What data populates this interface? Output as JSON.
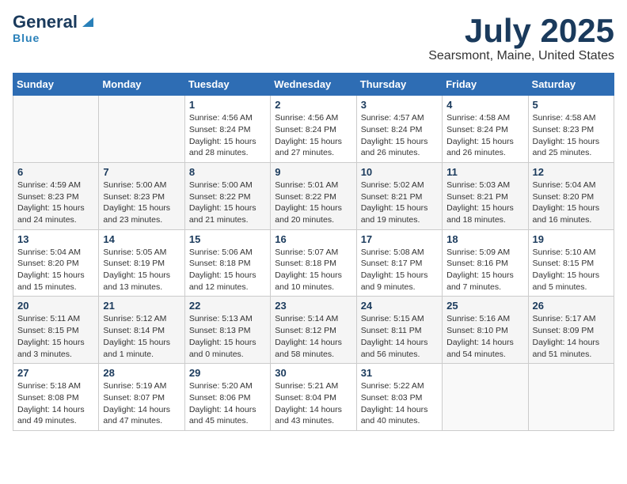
{
  "header": {
    "logo_general": "General",
    "logo_blue": "Blue",
    "title": "July 2025",
    "subtitle": "Searsmont, Maine, United States"
  },
  "calendar": {
    "weekdays": [
      "Sunday",
      "Monday",
      "Tuesday",
      "Wednesday",
      "Thursday",
      "Friday",
      "Saturday"
    ],
    "weeks": [
      [
        {
          "day": "",
          "info": ""
        },
        {
          "day": "",
          "info": ""
        },
        {
          "day": "1",
          "info": "Sunrise: 4:56 AM\nSunset: 8:24 PM\nDaylight: 15 hours and 28 minutes."
        },
        {
          "day": "2",
          "info": "Sunrise: 4:56 AM\nSunset: 8:24 PM\nDaylight: 15 hours and 27 minutes."
        },
        {
          "day": "3",
          "info": "Sunrise: 4:57 AM\nSunset: 8:24 PM\nDaylight: 15 hours and 26 minutes."
        },
        {
          "day": "4",
          "info": "Sunrise: 4:58 AM\nSunset: 8:24 PM\nDaylight: 15 hours and 26 minutes."
        },
        {
          "day": "5",
          "info": "Sunrise: 4:58 AM\nSunset: 8:23 PM\nDaylight: 15 hours and 25 minutes."
        }
      ],
      [
        {
          "day": "6",
          "info": "Sunrise: 4:59 AM\nSunset: 8:23 PM\nDaylight: 15 hours and 24 minutes."
        },
        {
          "day": "7",
          "info": "Sunrise: 5:00 AM\nSunset: 8:23 PM\nDaylight: 15 hours and 23 minutes."
        },
        {
          "day": "8",
          "info": "Sunrise: 5:00 AM\nSunset: 8:22 PM\nDaylight: 15 hours and 21 minutes."
        },
        {
          "day": "9",
          "info": "Sunrise: 5:01 AM\nSunset: 8:22 PM\nDaylight: 15 hours and 20 minutes."
        },
        {
          "day": "10",
          "info": "Sunrise: 5:02 AM\nSunset: 8:21 PM\nDaylight: 15 hours and 19 minutes."
        },
        {
          "day": "11",
          "info": "Sunrise: 5:03 AM\nSunset: 8:21 PM\nDaylight: 15 hours and 18 minutes."
        },
        {
          "day": "12",
          "info": "Sunrise: 5:04 AM\nSunset: 8:20 PM\nDaylight: 15 hours and 16 minutes."
        }
      ],
      [
        {
          "day": "13",
          "info": "Sunrise: 5:04 AM\nSunset: 8:20 PM\nDaylight: 15 hours and 15 minutes."
        },
        {
          "day": "14",
          "info": "Sunrise: 5:05 AM\nSunset: 8:19 PM\nDaylight: 15 hours and 13 minutes."
        },
        {
          "day": "15",
          "info": "Sunrise: 5:06 AM\nSunset: 8:18 PM\nDaylight: 15 hours and 12 minutes."
        },
        {
          "day": "16",
          "info": "Sunrise: 5:07 AM\nSunset: 8:18 PM\nDaylight: 15 hours and 10 minutes."
        },
        {
          "day": "17",
          "info": "Sunrise: 5:08 AM\nSunset: 8:17 PM\nDaylight: 15 hours and 9 minutes."
        },
        {
          "day": "18",
          "info": "Sunrise: 5:09 AM\nSunset: 8:16 PM\nDaylight: 15 hours and 7 minutes."
        },
        {
          "day": "19",
          "info": "Sunrise: 5:10 AM\nSunset: 8:15 PM\nDaylight: 15 hours and 5 minutes."
        }
      ],
      [
        {
          "day": "20",
          "info": "Sunrise: 5:11 AM\nSunset: 8:15 PM\nDaylight: 15 hours and 3 minutes."
        },
        {
          "day": "21",
          "info": "Sunrise: 5:12 AM\nSunset: 8:14 PM\nDaylight: 15 hours and 1 minute."
        },
        {
          "day": "22",
          "info": "Sunrise: 5:13 AM\nSunset: 8:13 PM\nDaylight: 15 hours and 0 minutes."
        },
        {
          "day": "23",
          "info": "Sunrise: 5:14 AM\nSunset: 8:12 PM\nDaylight: 14 hours and 58 minutes."
        },
        {
          "day": "24",
          "info": "Sunrise: 5:15 AM\nSunset: 8:11 PM\nDaylight: 14 hours and 56 minutes."
        },
        {
          "day": "25",
          "info": "Sunrise: 5:16 AM\nSunset: 8:10 PM\nDaylight: 14 hours and 54 minutes."
        },
        {
          "day": "26",
          "info": "Sunrise: 5:17 AM\nSunset: 8:09 PM\nDaylight: 14 hours and 51 minutes."
        }
      ],
      [
        {
          "day": "27",
          "info": "Sunrise: 5:18 AM\nSunset: 8:08 PM\nDaylight: 14 hours and 49 minutes."
        },
        {
          "day": "28",
          "info": "Sunrise: 5:19 AM\nSunset: 8:07 PM\nDaylight: 14 hours and 47 minutes."
        },
        {
          "day": "29",
          "info": "Sunrise: 5:20 AM\nSunset: 8:06 PM\nDaylight: 14 hours and 45 minutes."
        },
        {
          "day": "30",
          "info": "Sunrise: 5:21 AM\nSunset: 8:04 PM\nDaylight: 14 hours and 43 minutes."
        },
        {
          "day": "31",
          "info": "Sunrise: 5:22 AM\nSunset: 8:03 PM\nDaylight: 14 hours and 40 minutes."
        },
        {
          "day": "",
          "info": ""
        },
        {
          "day": "",
          "info": ""
        }
      ]
    ]
  }
}
